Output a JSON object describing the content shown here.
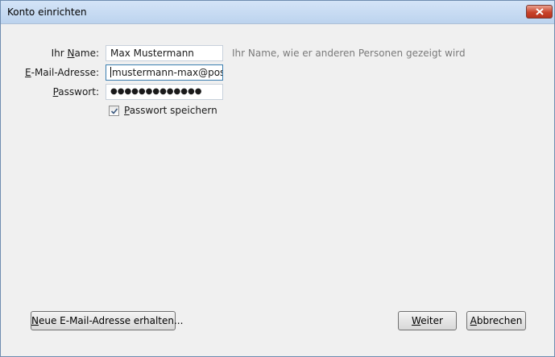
{
  "window": {
    "title": "Konto einrichten"
  },
  "form": {
    "name_label_pre": "Ihr ",
    "name_label_u": "N",
    "name_label_post": "ame:",
    "name_value": "Max Mustermann",
    "name_hint": "Ihr Name, wie er anderen Personen gezeigt wird",
    "email_label_u": "E",
    "email_label_post": "-Mail-Adresse:",
    "email_value": "mustermann-max@postec",
    "password_label_u": "P",
    "password_label_post": "asswort:",
    "password_value": "●●●●●●●●●●●●●",
    "save_password_checked": true,
    "save_password_u": "P",
    "save_password_post": "asswort speichern"
  },
  "buttons": {
    "new_email_u": "N",
    "new_email_post": "eue E-Mail-Adresse erhalten...",
    "next_u": "W",
    "next_post": "eiter",
    "cancel_u": "A",
    "cancel_post": "bbrechen"
  },
  "icons": {
    "close": "close-icon",
    "checkmark": "checkmark-icon"
  },
  "colors": {
    "close_button": "#c8432b",
    "hint_text": "#7a7a7a",
    "focus_border": "#3c7fb1"
  }
}
